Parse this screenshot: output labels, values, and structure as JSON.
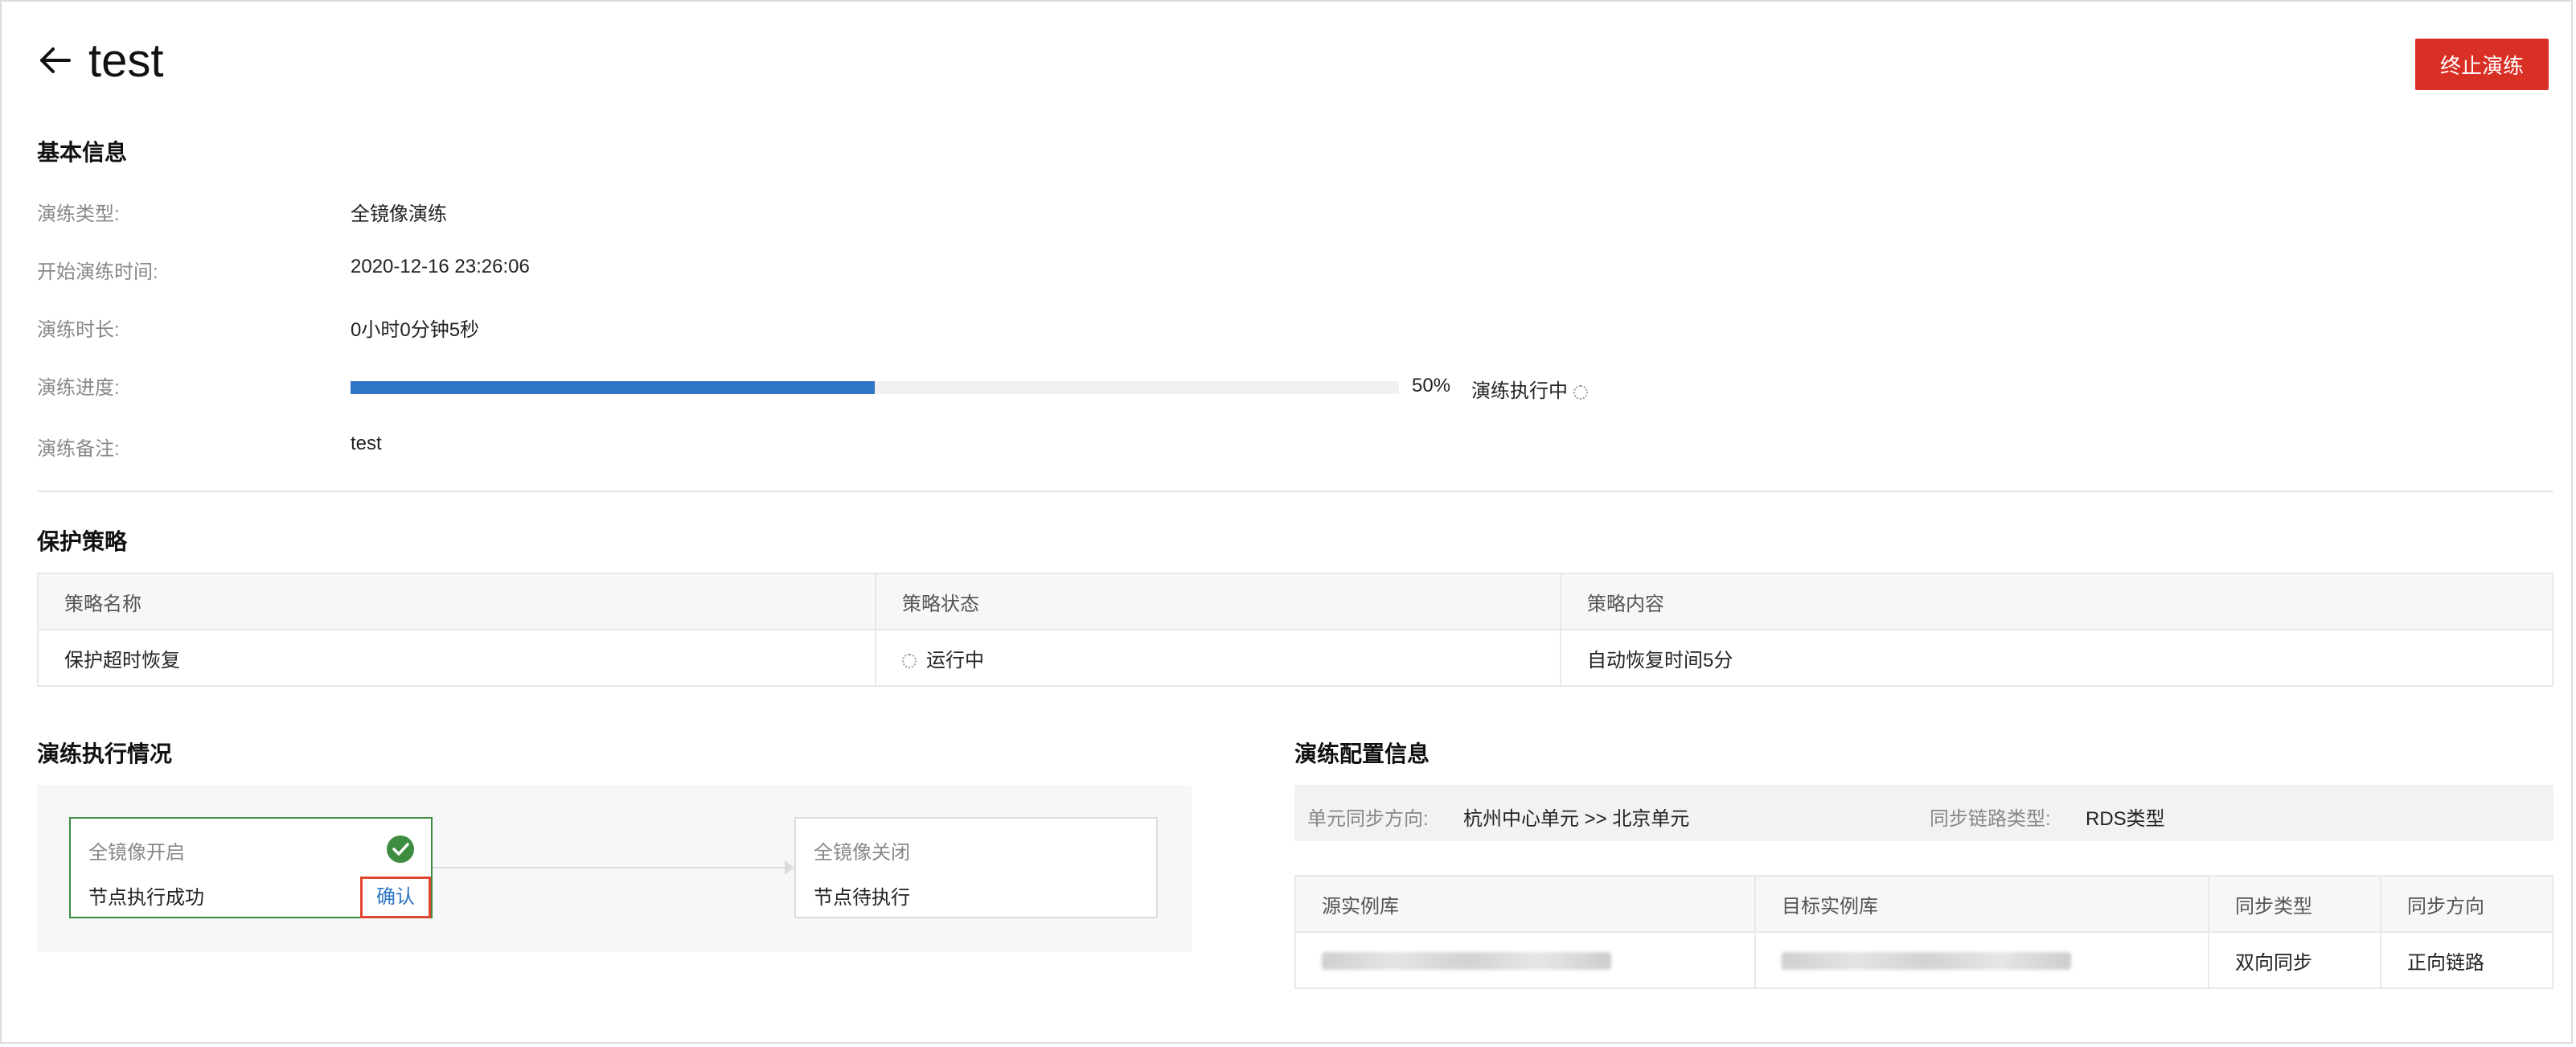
{
  "header": {
    "title": "test",
    "stop_button": "终止演练"
  },
  "basic_info": {
    "title": "基本信息",
    "rows": [
      {
        "label": "演练类型:",
        "value": "全镜像演练"
      },
      {
        "label": "开始演练时间:",
        "value": "2020-12-16 23:26:06"
      },
      {
        "label": "演练时长:",
        "value": "0小时0分钟5秒"
      },
      {
        "label": "演练进度:",
        "value": ""
      },
      {
        "label": "演练备注:",
        "value": "test"
      }
    ],
    "progress": {
      "percent": 50,
      "percent_label": "50%",
      "status": "演练执行中"
    }
  },
  "protection": {
    "title": "保护策略",
    "columns": [
      "策略名称",
      "策略状态",
      "策略内容"
    ],
    "rows": [
      {
        "name": "保护超时恢复",
        "status": "运行中",
        "content": "自动恢复时间5分"
      }
    ]
  },
  "execution": {
    "title": "演练执行情况",
    "nodes": [
      {
        "title": "全镜像开启",
        "status": "节点执行成功",
        "action": "确认"
      },
      {
        "title": "全镜像关闭",
        "status": "节点待执行"
      }
    ]
  },
  "config": {
    "title": "演练配置信息",
    "sync_direction_label": "单元同步方向:",
    "sync_direction_value": "杭州中心单元 >> 北京单元",
    "link_type_label": "同步链路类型:",
    "link_type_value": "RDS类型",
    "columns": [
      "源实例库",
      "目标实例库",
      "同步类型",
      "同步方向"
    ],
    "rows": [
      {
        "source": "",
        "target": "",
        "sync_type": "双向同步",
        "sync_direction": "正向链路"
      }
    ]
  },
  "colors": {
    "danger": "#d93026",
    "progress": "#2e75c6",
    "success": "#3d8c40",
    "highlight_border": "#e0452e"
  }
}
